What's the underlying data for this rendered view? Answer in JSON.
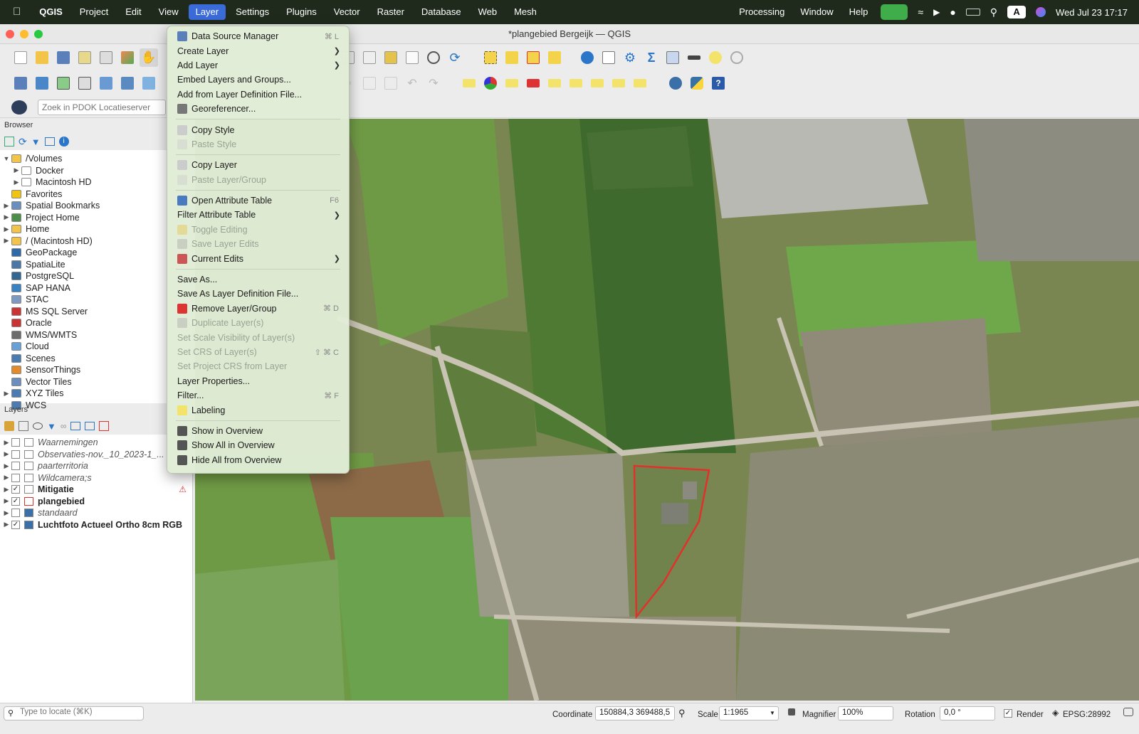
{
  "menubar": {
    "items": [
      "QGIS",
      "Project",
      "Edit",
      "View",
      "Layer",
      "Settings",
      "Plugins",
      "Vector",
      "Raster",
      "Database",
      "Web",
      "Mesh"
    ],
    "right_items": [
      "Processing",
      "Window",
      "Help"
    ],
    "clock": "Wed Jul 23  17:17"
  },
  "window": {
    "title": "*plangebied Bergeijk — QGIS"
  },
  "search": {
    "placeholder": "Zoek in PDOK Locatieserver"
  },
  "browser": {
    "title": "Browser",
    "items": [
      {
        "label": "/Volumes",
        "expanded": true,
        "indent": 0
      },
      {
        "label": "Docker",
        "indent": 1
      },
      {
        "label": "Macintosh HD",
        "indent": 1
      },
      {
        "label": "Favorites",
        "indent": 0
      },
      {
        "label": "Spatial Bookmarks",
        "indent": 0
      },
      {
        "label": "Project Home",
        "indent": 0
      },
      {
        "label": "Home",
        "indent": 0
      },
      {
        "label": "/ (Macintosh HD)",
        "indent": 0
      },
      {
        "label": "GeoPackage",
        "indent": 0
      },
      {
        "label": "SpatiaLite",
        "indent": 0
      },
      {
        "label": "PostgreSQL",
        "indent": 0
      },
      {
        "label": "SAP HANA",
        "indent": 0
      },
      {
        "label": "STAC",
        "indent": 0
      },
      {
        "label": "MS SQL Server",
        "indent": 0
      },
      {
        "label": "Oracle",
        "indent": 0
      },
      {
        "label": "WMS/WMTS",
        "indent": 0
      },
      {
        "label": "Cloud",
        "indent": 0
      },
      {
        "label": "Scenes",
        "indent": 0
      },
      {
        "label": "SensorThings",
        "indent": 0
      },
      {
        "label": "Vector Tiles",
        "indent": 0
      },
      {
        "label": "XYZ Tiles",
        "indent": 0
      },
      {
        "label": "WCS",
        "indent": 0
      }
    ]
  },
  "layers": {
    "title": "Layers",
    "items": [
      {
        "label": "Waarnemingen",
        "checked": false
      },
      {
        "label": "Observaties-nov._10_2023-1_...",
        "checked": false
      },
      {
        "label": "paarterritoria",
        "checked": false
      },
      {
        "label": "Wildcamera;s",
        "checked": false
      },
      {
        "label": "Mitigatie",
        "checked": true
      },
      {
        "label": "plangebied",
        "checked": true
      },
      {
        "label": "standaard",
        "checked": false
      },
      {
        "label": "Luchtfoto Actueel Ortho 8cm RGB",
        "checked": true
      }
    ]
  },
  "layer_menu": {
    "items": [
      {
        "label": "Data Source Manager",
        "shortcut": "⌘ L",
        "icon": "data-source-icon"
      },
      {
        "label": "Create Layer",
        "submenu": true
      },
      {
        "label": "Add Layer",
        "submenu": true
      },
      {
        "label": "Embed Layers and Groups..."
      },
      {
        "label": "Add from Layer Definition File..."
      },
      {
        "label": "Georeferencer...",
        "icon": "georeferencer-icon"
      },
      {
        "sep": true
      },
      {
        "label": "Copy Style",
        "icon": "copy-style-icon"
      },
      {
        "label": "Paste Style",
        "disabled": true,
        "icon": "paste-style-icon"
      },
      {
        "sep": true
      },
      {
        "label": "Copy Layer",
        "icon": "copy-layer-icon"
      },
      {
        "label": "Paste Layer/Group",
        "disabled": true,
        "icon": "paste-layer-icon"
      },
      {
        "sep": true
      },
      {
        "label": "Open Attribute Table",
        "shortcut": "F6",
        "icon": "attribute-table-icon"
      },
      {
        "label": "Filter Attribute Table",
        "submenu": true
      },
      {
        "label": "Toggle Editing",
        "disabled": true,
        "icon": "pencil-icon"
      },
      {
        "label": "Save Layer Edits",
        "disabled": true,
        "icon": "save-edits-icon"
      },
      {
        "label": "Current Edits",
        "submenu": true,
        "icon": "current-edits-icon"
      },
      {
        "sep": true
      },
      {
        "label": "Save As..."
      },
      {
        "label": "Save As Layer Definition File..."
      },
      {
        "label": "Remove Layer/Group",
        "shortcut": "⌘ D",
        "icon": "remove-layer-icon"
      },
      {
        "label": "Duplicate Layer(s)",
        "disabled": true,
        "icon": "duplicate-layer-icon"
      },
      {
        "label": "Set Scale Visibility of Layer(s)",
        "disabled": true
      },
      {
        "label": "Set CRS of Layer(s)",
        "disabled": true,
        "shortcut": "⇧ ⌘ C"
      },
      {
        "label": "Set Project CRS from Layer",
        "disabled": true
      },
      {
        "label": "Layer Properties..."
      },
      {
        "label": "Filter...",
        "shortcut": "⌘ F"
      },
      {
        "label": "Labeling",
        "icon": "labeling-icon"
      },
      {
        "sep": true
      },
      {
        "label": "Show in Overview",
        "icon": "overview-icon"
      },
      {
        "label": "Show All in Overview",
        "icon": "overview-all-icon"
      },
      {
        "label": "Hide All from Overview",
        "icon": "overview-hide-icon"
      }
    ]
  },
  "statusbar": {
    "locate_placeholder": "Type to locate (⌘K)",
    "coordinate_label": "Coordinate",
    "coordinate_value": "150884,3  369488,5",
    "scale_label": "Scale",
    "scale_value": "1:1965",
    "magnifier_label": "Magnifier",
    "magnifier_value": "100%",
    "rotation_label": "Rotation",
    "rotation_value": "0,0 °",
    "render_label": "Render",
    "crs": "EPSG:28992"
  },
  "colors": {
    "menu_highlight": "#3b6bd9",
    "polygon_outline": "#e0322b"
  }
}
